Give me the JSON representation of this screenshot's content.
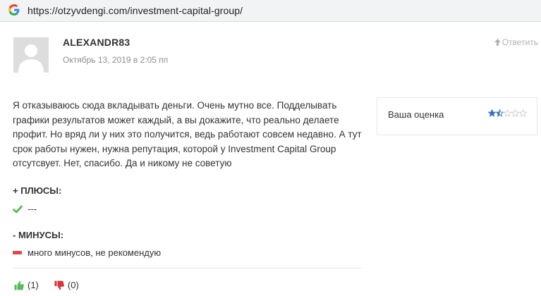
{
  "browser": {
    "url": "https://otzyvdengi.com/investment-capital-group/"
  },
  "comment": {
    "author": "ALEXANDR83",
    "date": "Октябрь 13, 2019 в 2:05 пп",
    "reply_label": "Ответить",
    "text": "Я отказываюсь сюда вкладывать деньги. Очень мутно все. Подделывать графики результатов может каждый, а вы докажите, что реально делаете профит. Но вряд ли у них это получится, ведь работают совсем недавно. А тут срок работы нужен, нужна репутация, которой у Investment Capital Group отсутсвует. Нет, спасибо. Да и никому не советую",
    "pros_title": "+ ПЛЮСЫ:",
    "pros_text": "---",
    "cons_title": "- МИНУСЫ:",
    "cons_text": "много минусов, не рекомендую",
    "likes": "(1)",
    "dislikes": "(0)"
  },
  "rating": {
    "label": "Ваша оценка",
    "value": 1.5,
    "max": 5,
    "star_color": "#3a6fc4",
    "empty_color": "#c9c9c9"
  },
  "colors": {
    "check": "#5cb85c",
    "minus": "#e0474c",
    "thumb_up": "#5cb85c",
    "thumb_down": "#d9343a"
  }
}
